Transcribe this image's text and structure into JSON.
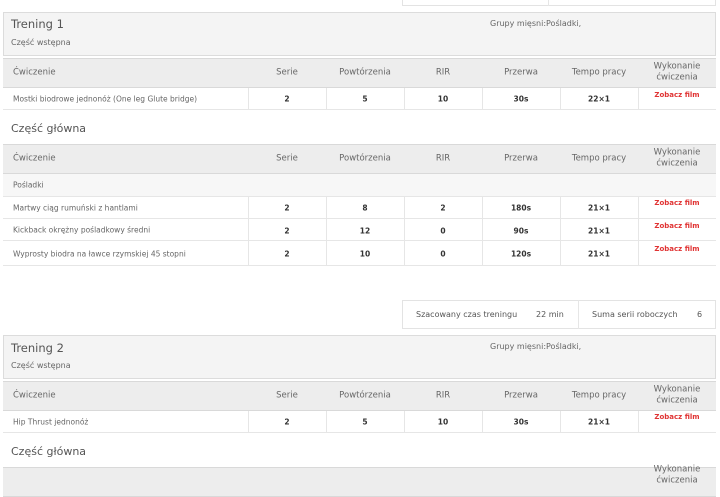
{
  "columns": {
    "exercise": "Ćwiczenie",
    "sets": "Serie",
    "reps": "Powtórzenia",
    "rir": "RIR",
    "rest": "Przerwa",
    "tempo": "Tempo pracy",
    "video": "Wykonanie ćwiczenia"
  },
  "video_link_label": "Zobacz film",
  "trainings": [
    {
      "title": "Trening 1",
      "muscle_groups": "Grupy mięsni:Pośladki,",
      "warmup": {
        "label": "Część wstępna",
        "rows": [
          {
            "name": "Mostki biodrowe jednonóż (One leg Glute bridge)",
            "sets": "2",
            "reps": "5",
            "rir": "10",
            "rest": "30s",
            "tempo": "22×1"
          }
        ]
      },
      "main": {
        "label": "Część główna",
        "groups": [
          {
            "group": "Pośladki",
            "rows": [
              {
                "name": "Martwy ciąg rumuński z hantlami",
                "sets": "2",
                "reps": "8",
                "rir": "2",
                "rest": "180s",
                "tempo": "21×1"
              },
              {
                "name": "Kickback okrężny pośladkowy średni",
                "sets": "2",
                "reps": "12",
                "rir": "0",
                "rest": "90s",
                "tempo": "21×1"
              },
              {
                "name": "Wyprosty biodra na ławce rzymskiej 45 stopni",
                "sets": "2",
                "reps": "10",
                "rir": "0",
                "rest": "120s",
                "tempo": "21×1"
              }
            ]
          }
        ]
      }
    },
    {
      "summary": {
        "time_label": "Szacowany czas treningu",
        "time_value": "22 min",
        "sets_label": "Suma serii roboczych",
        "sets_value": "6"
      },
      "title": "Trening 2",
      "muscle_groups": "Grupy mięsni:Pośladki,",
      "warmup": {
        "label": "Część wstępna",
        "rows": [
          {
            "name": "Hip Thrust jednonóż",
            "sets": "2",
            "reps": "5",
            "rir": "10",
            "rest": "30s",
            "tempo": "21×1"
          }
        ]
      },
      "main": {
        "label": "Część główna"
      }
    }
  ]
}
